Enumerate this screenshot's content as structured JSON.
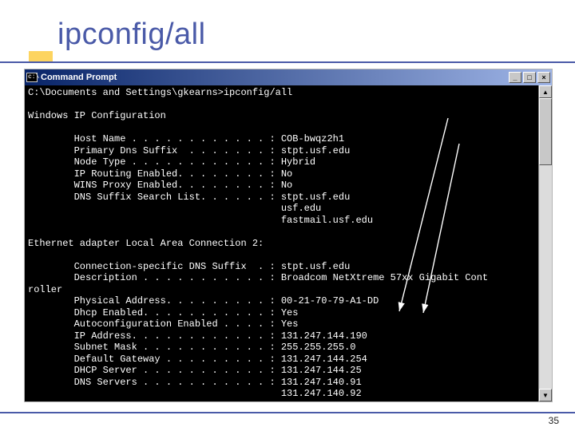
{
  "slide": {
    "title": "ipconfig/all",
    "page_number": "35"
  },
  "window": {
    "title": "Command Prompt"
  },
  "console": {
    "prompt_line": "C:\\Documents and Settings\\gkearns>ipconfig/all",
    "heading1": "Windows IP Configuration",
    "host_name_line": "        Host Name . . . . . . . . . . . . : COB-bwqz2h1",
    "primary_dns_suffix_line": "        Primary Dns Suffix  . . . . . . . : stpt.usf.edu",
    "node_type_line": "        Node Type . . . . . . . . . . . . : Hybrid",
    "ip_routing_line": "        IP Routing Enabled. . . . . . . . : No",
    "wins_proxy_line": "        WINS Proxy Enabled. . . . . . . . : No",
    "dns_suffix_list_line": "        DNS Suffix Search List. . . . . . : stpt.usf.edu",
    "dns_suffix_list_2": "                                            usf.edu",
    "dns_suffix_list_3": "                                            fastmail.usf.edu",
    "adapter_heading": "Ethernet adapter Local Area Connection 2:",
    "conn_dns_suffix_line": "        Connection-specific DNS Suffix  . : stpt.usf.edu",
    "description_line": "        Description . . . . . . . . . . . : Broadcom NetXtreme 57xx Gigabit Cont",
    "description_wrap": "roller",
    "phys_addr_line": "        Physical Address. . . . . . . . . : 00-21-70-79-A1-DD",
    "dhcp_enabled_line": "        Dhcp Enabled. . . . . . . . . . . : Yes",
    "autoconfig_line": "        Autoconfiguration Enabled . . . . : Yes",
    "ip_address_line": "        IP Address. . . . . . . . . . . . : 131.247.144.190",
    "subnet_mask_line": "        Subnet Mask . . . . . . . . . . . : 255.255.255.0",
    "default_gateway_line": "        Default Gateway . . . . . . . . . : 131.247.144.254",
    "dhcp_server_line": "        DHCP Server . . . . . . . . . . . : 131.247.144.25",
    "dns_servers_line": "        DNS Servers . . . . . . . . . . . : 131.247.140.91",
    "dns_servers_2": "                                            131.247.140.92"
  }
}
